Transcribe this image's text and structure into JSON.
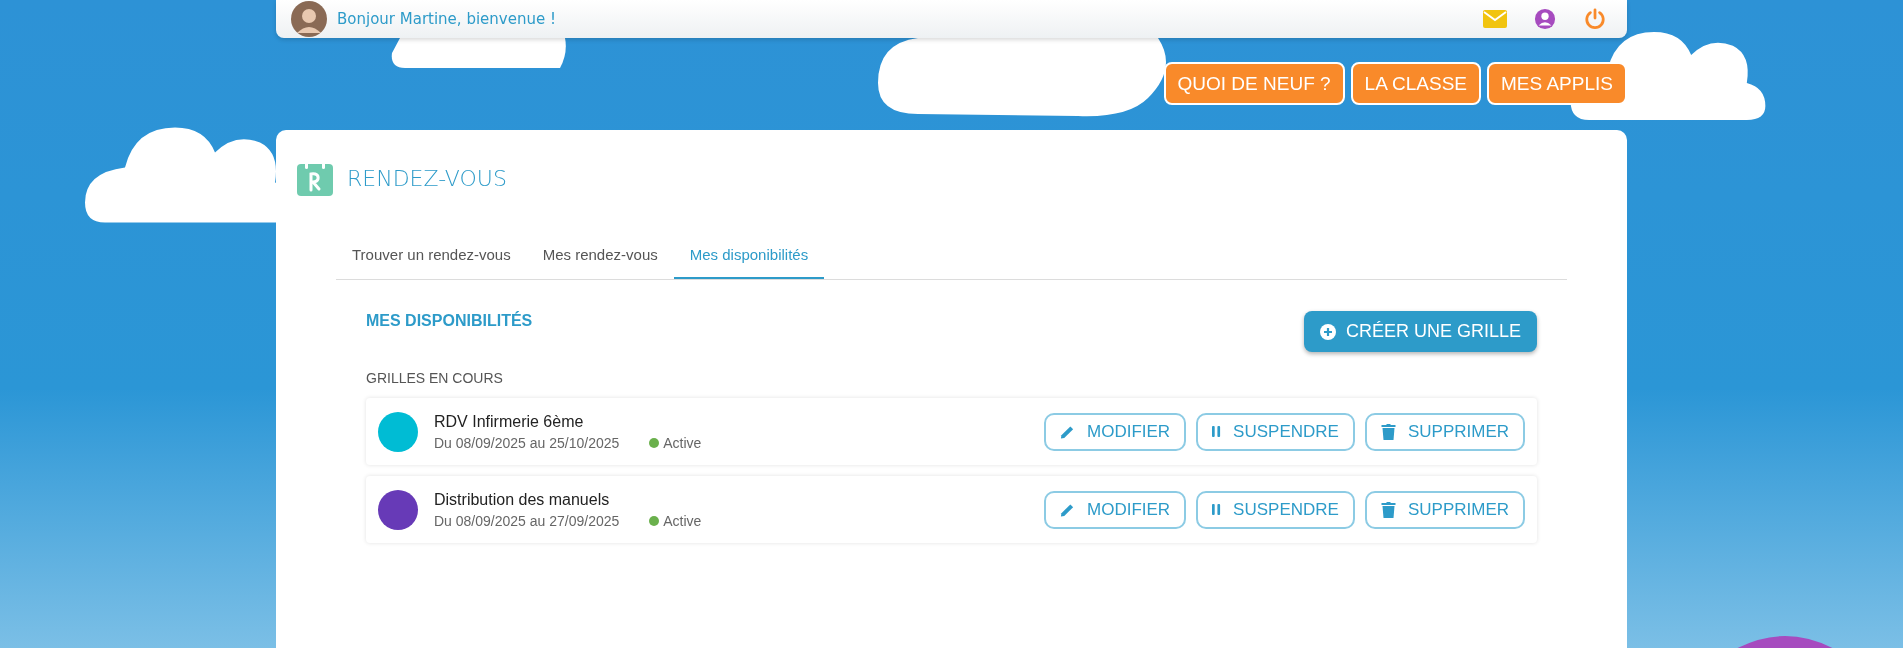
{
  "header": {
    "greeting": "Bonjour Martine, bienvenue !"
  },
  "nav": [
    {
      "label": "QUOI DE NEUF ?"
    },
    {
      "label": "LA CLASSE"
    },
    {
      "label": "MES APPLIS"
    }
  ],
  "page": {
    "title": "RENDEZ-VOUS"
  },
  "tabs": [
    {
      "label": "Trouver un rendez-vous",
      "selected": false
    },
    {
      "label": "Mes rendez-vous",
      "selected": false
    },
    {
      "label": "Mes disponibilités",
      "selected": true
    }
  ],
  "section": {
    "title": "MES DISPONIBILITÉS",
    "create_button": "CRÉER UNE GRILLE",
    "subtitle": "GRILLES EN COURS"
  },
  "grids": [
    {
      "name": "RDV Infirmerie 6ème",
      "dates": "Du 08/09/2025 au 25/10/2025",
      "status": "Active",
      "active": true,
      "color": "#00bcd4",
      "actions": [
        {
          "kind": "edit",
          "label": "MODIFIER"
        },
        {
          "kind": "pause",
          "label": "SUSPENDRE"
        },
        {
          "kind": "delete",
          "label": "SUPPRIMER"
        }
      ]
    },
    {
      "name": "Distribution des manuels",
      "dates": "Du 08/09/2025 au 27/09/2025",
      "status": "Active",
      "active": true,
      "color": "#673ab7",
      "actions": [
        {
          "kind": "edit",
          "label": "MODIFIER"
        },
        {
          "kind": "pause",
          "label": "SUSPENDRE"
        },
        {
          "kind": "delete",
          "label": "SUPPRIMER"
        }
      ]
    }
  ]
}
